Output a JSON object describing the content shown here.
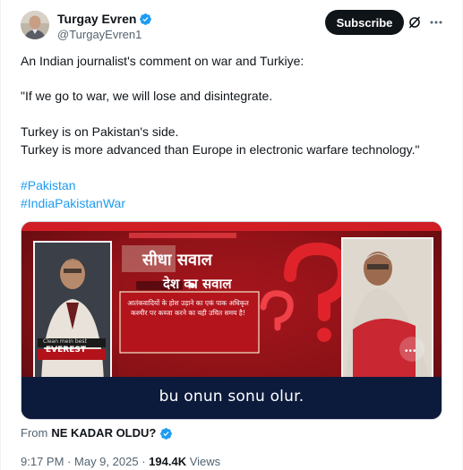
{
  "author": {
    "display_name": "Turgay Evren",
    "handle": "@TurgayEvren1",
    "avatar_icon": "avatar-photo",
    "verified_icon": "verified-badge-icon"
  },
  "actions": {
    "subscribe_label": "Subscribe",
    "grok_icon": "grok-icon",
    "more_icon": "more-dots-icon"
  },
  "tweet": {
    "paragraph_1": "An Indian journalist's comment on war and Turkiye:",
    "paragraph_2": "\"If we go to war, we will lose and disintegrate.",
    "paragraph_3": "Turkey is on Pakistan's side.",
    "paragraph_4": "Turkey is more advanced than Europe in electronic warfare technology.\"",
    "hashtags": [
      "#Pakistan",
      "#IndiaPakistanWar"
    ]
  },
  "media": {
    "caption": "bu onun sonu olur.",
    "headline_1": "सीधा सवाल",
    "headline_2": "देश का सवाल",
    "body": "आतंकवादियों के होश उड़ाने का एकं पाक अधिकृत कश्मीर पर कब्जा करने का यही उचित समय है!",
    "ticker": "EVEREST",
    "ticker_small": "Clean mein best"
  },
  "source": {
    "prefix": "From",
    "name": "NE KADAR OLDU?"
  },
  "meta": {
    "time": "9:17 PM",
    "separator": "·",
    "date": "May 9, 2025",
    "views_count": "194.4K",
    "views_label": "Views"
  },
  "colors": {
    "accent": "#1d9bf0",
    "text": "#0f1419",
    "secondary": "#536471",
    "button_bg": "#0f1419"
  }
}
